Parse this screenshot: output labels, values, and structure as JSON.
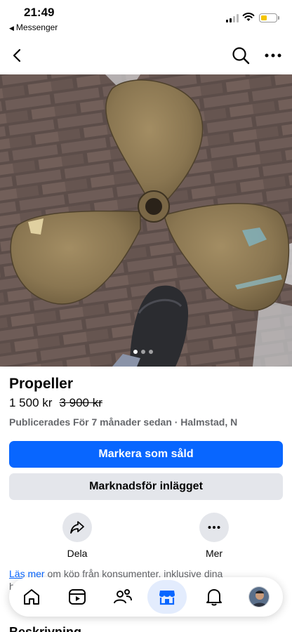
{
  "status_bar": {
    "time": "21:49",
    "back_app": "Messenger",
    "battery_color": "#f4c400"
  },
  "nav": {
    "back_icon": "chevron-left-icon",
    "search_icon": "search-icon",
    "more_icon": "more-horizontal-icon"
  },
  "photo": {
    "description_alt": "",
    "carousel_count": 3,
    "carousel_active_index": 0
  },
  "listing": {
    "title": "Propeller",
    "price": "1 500 kr",
    "original_price": "3 900 kr",
    "meta": "Publicerades För 7 månader sedan · Halmstad, N"
  },
  "buttons": {
    "mark_sold": "Markera som såld",
    "promote": "Marknadsför inlägget"
  },
  "actions": {
    "share_label": "Dela",
    "more_label": "Mer"
  },
  "info": {
    "link_1": "Läs",
    "link_2": "mer",
    "text": " om köp från konsumenter, inklusive dina",
    "cut_line": "h"
  },
  "section": {
    "heading_cut": "Beskrivning"
  },
  "tabs": [
    {
      "name": "home",
      "icon": "home-icon"
    },
    {
      "name": "video",
      "icon": "video-icon"
    },
    {
      "name": "friends",
      "icon": "friends-icon"
    },
    {
      "name": "marketplace",
      "icon": "marketplace-icon",
      "active": true
    },
    {
      "name": "notifications",
      "icon": "bell-icon"
    },
    {
      "name": "profile",
      "icon": "avatar"
    }
  ],
  "colors": {
    "accent": "#0866ff",
    "secondary_button": "#e4e6eb",
    "muted_text": "#65676b",
    "active_tab_bg": "#e3ecfd"
  }
}
